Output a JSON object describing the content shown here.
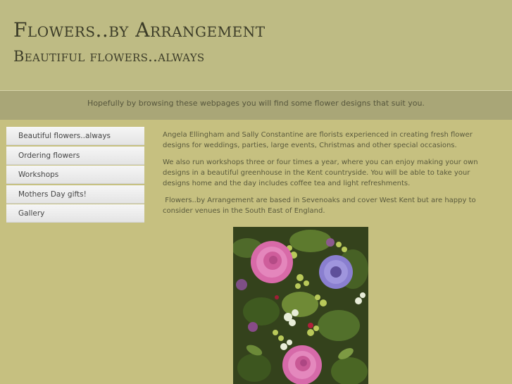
{
  "header": {
    "title": "Flowers..by Arrangement",
    "subtitle": "Beautiful flowers..always"
  },
  "band": {
    "tagline": "Hopefully by browsing these webpages you will find some flower designs that suit you."
  },
  "nav": {
    "items": [
      {
        "label": "Beautiful flowers..always"
      },
      {
        "label": "Ordering flowers"
      },
      {
        "label": "Workshops"
      },
      {
        "label": "Mothers Day gifts!"
      },
      {
        "label": "Gallery"
      }
    ]
  },
  "content": {
    "paragraphs": [
      "Angela Ellingham and Sally Constantine are florists experienced in creating fresh flower designs for weddings, parties, large events, Christmas and other special occasions.",
      "We also run workshops three or four times a year, where you can enjoy making your own designs in a beautiful greenhouse in the Kent countryside. You will be able to take your designs home and the day includes coffee tea and light refreshments.",
      " Flowers..by Arrangement are based in Sevenoaks and cover West Kent but are happy to consider venues in the South East of England."
    ]
  },
  "colors": {
    "background": "#c6c080",
    "header": "#bebb84",
    "band": "#a9a677",
    "title_text": "#3c3c28"
  }
}
